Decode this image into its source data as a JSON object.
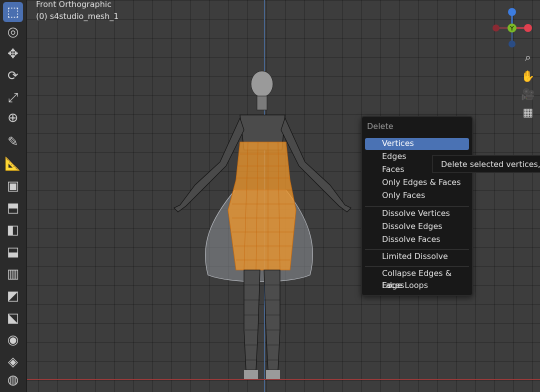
{
  "viewport": {
    "view_name": "Front Orthographic",
    "object_label": "(0) s4studio_mesh_1"
  },
  "toolbar": {
    "tools": [
      {
        "name": "select-box-icon",
        "glyph": "⬚",
        "active": true
      },
      {
        "name": "cursor-icon",
        "glyph": "◎",
        "active": false
      },
      {
        "name": "move-icon",
        "glyph": "✥",
        "active": false
      },
      {
        "name": "rotate-icon",
        "glyph": "⟳",
        "active": false
      },
      {
        "name": "scale-icon",
        "glyph": "⤢",
        "active": false
      },
      {
        "name": "transform-icon",
        "glyph": "⊕",
        "active": false
      },
      {
        "name": "annotate-icon",
        "glyph": "✎",
        "active": false
      },
      {
        "name": "measure-icon",
        "glyph": "📐",
        "active": false
      },
      {
        "name": "add-cube-icon",
        "glyph": "▣",
        "active": false
      },
      {
        "name": "extrude-icon",
        "glyph": "⬒",
        "active": false
      },
      {
        "name": "inset-icon",
        "glyph": "◧",
        "active": false
      },
      {
        "name": "bevel-icon",
        "glyph": "⬓",
        "active": false
      },
      {
        "name": "loop-cut-icon",
        "glyph": "▥",
        "active": false
      },
      {
        "name": "knife-icon",
        "glyph": "◩",
        "active": false
      },
      {
        "name": "poly-build-icon",
        "glyph": "⬕",
        "active": false
      },
      {
        "name": "spin-icon",
        "glyph": "◉",
        "active": false
      },
      {
        "name": "smooth-icon",
        "glyph": "◈",
        "active": false
      },
      {
        "name": "shrink-icon",
        "glyph": "◍",
        "active": false
      },
      {
        "name": "shear-icon",
        "glyph": "◪",
        "active": false
      }
    ]
  },
  "gizmo": {
    "axes": [
      {
        "name": "x",
        "color": "#e0404f"
      },
      {
        "name": "y",
        "color": "#7bb927"
      },
      {
        "name": "z",
        "color": "#3c7ce0"
      }
    ],
    "labels": {
      "x": "X",
      "y": "Y",
      "z": "Z"
    }
  },
  "nav_buttons": [
    {
      "name": "zoom-icon",
      "glyph": "⌕"
    },
    {
      "name": "pan-hand-icon",
      "glyph": "✋"
    },
    {
      "name": "camera-icon",
      "glyph": "🎥"
    },
    {
      "name": "grid-icon",
      "glyph": "▦"
    }
  ],
  "delete_menu": {
    "title": "Delete",
    "items": [
      {
        "label": "Vertices",
        "highlighted": true
      },
      {
        "label": "Edges",
        "highlighted": false
      },
      {
        "label": "Faces",
        "highlighted": false
      },
      {
        "label": "Only Edges & Faces",
        "highlighted": false
      },
      {
        "label": "Only Faces",
        "highlighted": false
      },
      {
        "label": "Dissolve Vertices",
        "highlighted": false
      },
      {
        "label": "Dissolve Edges",
        "highlighted": false
      },
      {
        "label": "Dissolve Faces",
        "highlighted": false
      },
      {
        "label": "Limited Dissolve",
        "highlighted": false
      },
      {
        "label": "Collapse Edges & Faces",
        "highlighted": false
      },
      {
        "label": "Edge Loops",
        "highlighted": false
      }
    ]
  },
  "tooltip": {
    "text": "Delete selected vertices, edges"
  },
  "colors": {
    "selection": "#f39a2c",
    "mesh_wire": "#111111",
    "highlight": "#4a72b4"
  }
}
